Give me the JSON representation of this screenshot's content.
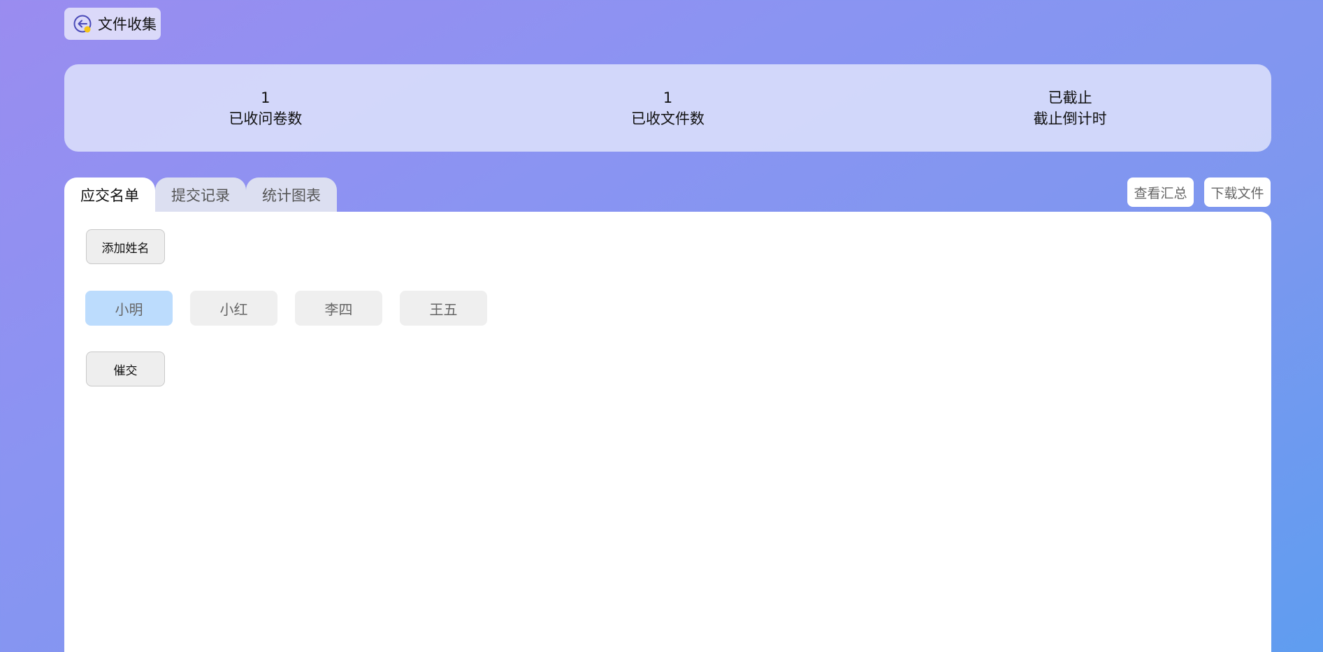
{
  "header": {
    "back_label": "文件收集",
    "back_icon": "back-arrow-icon"
  },
  "stats": [
    {
      "value": "1",
      "label": "已收问卷数"
    },
    {
      "value": "1",
      "label": "已收文件数"
    },
    {
      "value": "已截止",
      "label": "截止倒计时"
    }
  ],
  "tabs": [
    {
      "label": "应交名单",
      "active": true
    },
    {
      "label": "提交记录",
      "active": false
    },
    {
      "label": "统计图表",
      "active": false
    }
  ],
  "actions": {
    "summary_label": "查看汇总",
    "download_label": "下载文件"
  },
  "panel": {
    "add_name_label": "添加姓名",
    "remind_label": "催交",
    "names": [
      {
        "name": "小明",
        "selected": true
      },
      {
        "name": "小红",
        "selected": false
      },
      {
        "name": "李四",
        "selected": false
      },
      {
        "name": "王五",
        "selected": false
      }
    ]
  },
  "colors": {
    "selected_chip": "#bcdcfd",
    "icon_accent": "#f5c518",
    "icon_ring": "#4a4ab8"
  }
}
